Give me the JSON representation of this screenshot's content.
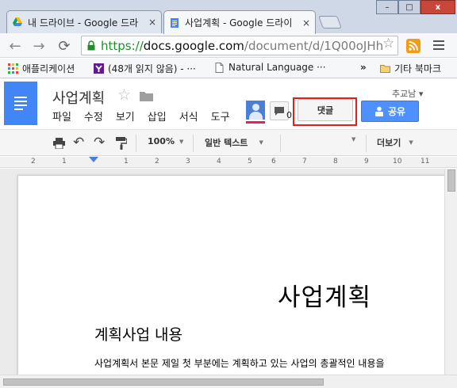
{
  "browser": {
    "tabs": [
      {
        "title": "내 드라이브 - Google 드라",
        "close": "×"
      },
      {
        "title": "사업계획 - Google 드라이",
        "close": "×"
      }
    ],
    "window_controls": {
      "minimize": "–",
      "maximize": "□",
      "close": "x"
    },
    "url": {
      "scheme": "https://",
      "host": "docs.google.com",
      "path": "/document/d/1Q00oJHh"
    },
    "bookmarks": [
      {
        "label": "애플리케이션",
        "icon": "apps-grid-icon"
      },
      {
        "label": "(48개 읽지 않음) - ···",
        "icon": "yahoo-icon"
      },
      {
        "label": "Natural Language ···",
        "icon": "page-icon"
      }
    ],
    "overflow": "»",
    "other_bookmarks": "기타 북마크"
  },
  "docs": {
    "title": "사업계획",
    "menu": [
      "파일",
      "수정",
      "보기",
      "삽입",
      "서식",
      "도구"
    ],
    "chat_hidden_suffix": "0",
    "comment_button": "댓글",
    "share_button": "공유",
    "user_email": "추교남 ▾",
    "colors": {
      "share": "#4d90fe",
      "logo": "#4285f4",
      "highlight": "#e02020",
      "avatar_bar": "#e91e63"
    }
  },
  "format_toolbar": {
    "zoom": "100%",
    "style": "일반 텍스트",
    "more": "더보기"
  },
  "ruler": {
    "numbers": [
      "2",
      "1",
      "1",
      "2",
      "3",
      "4",
      "5",
      "6",
      "7",
      "8",
      "9",
      "10",
      "11"
    ]
  },
  "document": {
    "title": "사업계획",
    "heading1": "계획사업 내용",
    "paragraph": "사업계획서 본문 제일 첫 부분에는 계획하고 있는 사업의 총괄적인 내용을"
  }
}
